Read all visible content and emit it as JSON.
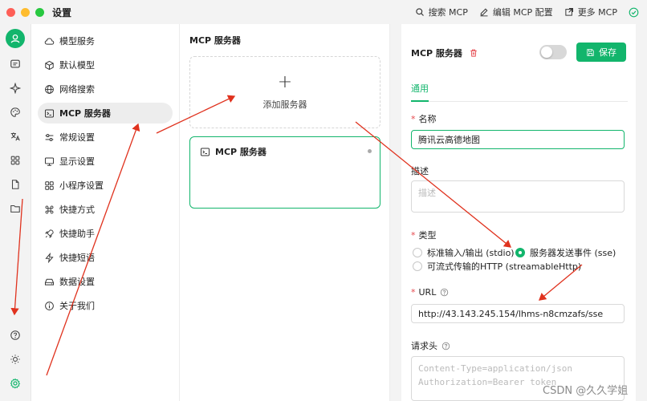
{
  "window": {
    "title": "设置"
  },
  "toolbar": {
    "search_label": "搜索 MCP",
    "edit_label": "编辑 MCP 配置",
    "more_label": "更多 MCP"
  },
  "menu": {
    "items": [
      {
        "label": "模型服务",
        "icon": "cloud-icon"
      },
      {
        "label": "默认模型",
        "icon": "box-icon"
      },
      {
        "label": "网络搜索",
        "icon": "globe-icon"
      },
      {
        "label": "MCP 服务器",
        "icon": "terminal-icon",
        "active": true
      },
      {
        "label": "常规设置",
        "icon": "sliders-icon"
      },
      {
        "label": "显示设置",
        "icon": "monitor-icon"
      },
      {
        "label": "小程序设置",
        "icon": "grid-icon"
      },
      {
        "label": "快捷方式",
        "icon": "command-icon"
      },
      {
        "label": "快捷助手",
        "icon": "rocket-icon"
      },
      {
        "label": "快捷短语",
        "icon": "zap-icon"
      },
      {
        "label": "数据设置",
        "icon": "drive-icon"
      },
      {
        "label": "关于我们",
        "icon": "info-icon"
      }
    ]
  },
  "list": {
    "title": "MCP 服务器",
    "add_label": "添加服务器",
    "add_symbol": "+",
    "server_name": "MCP 服务器"
  },
  "detail": {
    "title": "MCP 服务器",
    "save_label": "保存",
    "tab_general": "通用",
    "name_label": "名称",
    "name_value": "腾讯云高德地图",
    "desc_label": "描述",
    "desc_placeholder": "描述",
    "type_label": "类型",
    "type_options": [
      {
        "label": "标准输入/输出 (stdio)",
        "selected": false
      },
      {
        "label": "服务器发送事件 (sse)",
        "selected": true
      },
      {
        "label": "可流式传输的HTTP (streamableHttp)",
        "selected": false
      }
    ],
    "url_label": "URL",
    "url_value": "http://43.143.245.154/lhms-n8cmzafs/sse",
    "headers_label": "请求头",
    "headers_placeholder": "Content-Type=application/json\nAuthorization=Bearer token"
  },
  "watermark": "CSDN @久久学姐",
  "colors": {
    "accent": "#12b56c",
    "arrow": "#e0321e",
    "required": "#e5484d"
  }
}
